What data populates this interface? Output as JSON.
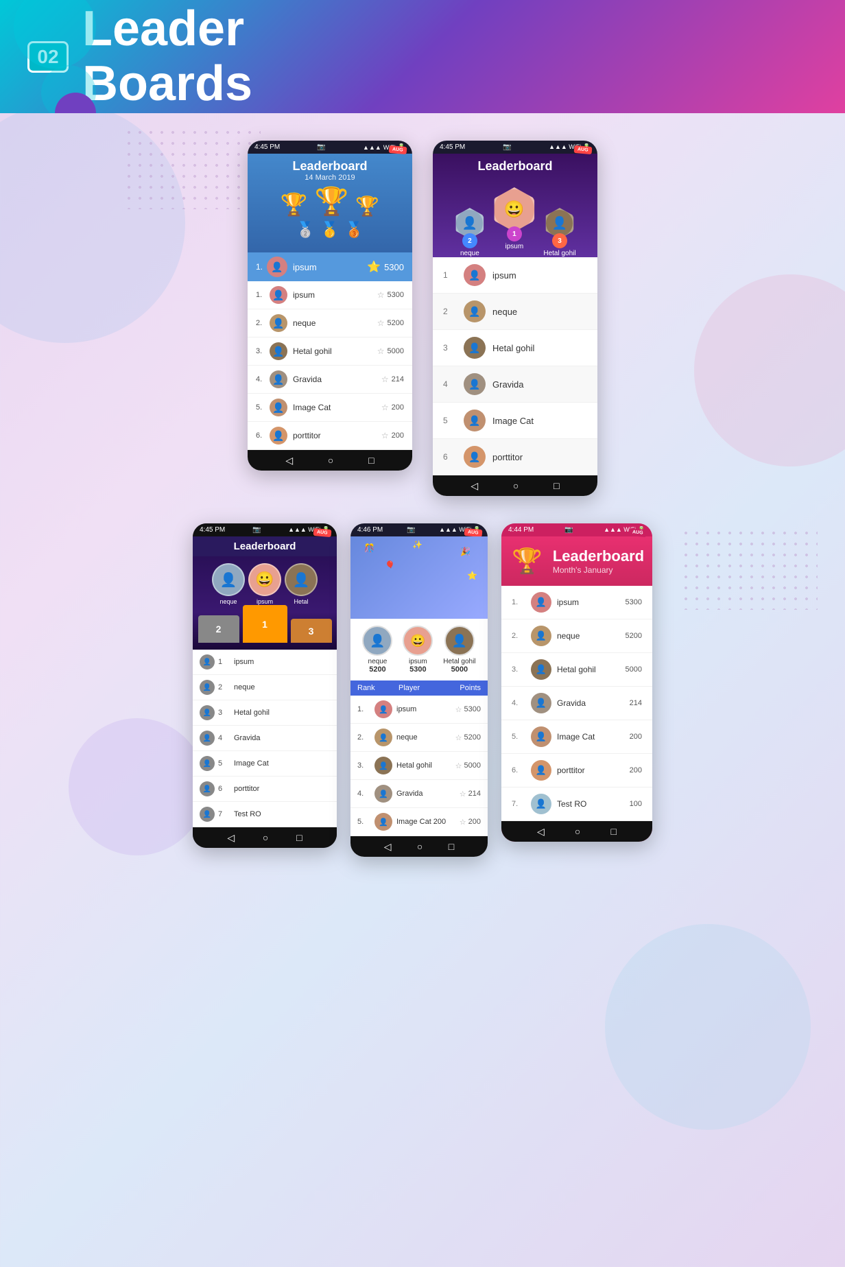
{
  "header": {
    "number": "02",
    "title": "Leader\nBoards"
  },
  "phone1": {
    "status_time": "4:45 PM",
    "title": "Leaderboard",
    "subtitle": "14 March 2019",
    "top_player": {
      "rank": "1.",
      "name": "ipsum",
      "score": "5300"
    },
    "players": [
      {
        "rank": "1.",
        "name": "ipsum",
        "score": "5300"
      },
      {
        "rank": "2.",
        "name": "neque",
        "score": "5200"
      },
      {
        "rank": "3.",
        "name": "Hetal gohil",
        "score": "5000"
      },
      {
        "rank": "4.",
        "name": "Gravida",
        "score": "214"
      },
      {
        "rank": "5.",
        "name": "Image Cat",
        "score": "200"
      },
      {
        "rank": "6.",
        "name": "porttitor",
        "score": "200"
      }
    ]
  },
  "phone2": {
    "status_time": "4:45 PM",
    "title": "Leaderboard",
    "podium": [
      {
        "rank": "2",
        "name": "neque",
        "position": "left"
      },
      {
        "rank": "1",
        "name": "ipsum",
        "position": "center"
      },
      {
        "rank": "3",
        "name": "Hetal gohil",
        "position": "right"
      }
    ],
    "players": [
      {
        "rank": "1",
        "name": "ipsum"
      },
      {
        "rank": "2",
        "name": "neque"
      },
      {
        "rank": "3",
        "name": "Hetal gohil"
      },
      {
        "rank": "4",
        "name": "Gravida"
      },
      {
        "rank": "5",
        "name": "Image Cat"
      },
      {
        "rank": "6",
        "name": "porttitor"
      }
    ]
  },
  "phone3": {
    "status_time": "4:45 PM",
    "title": "Leaderboard",
    "podium": [
      {
        "name": "neque",
        "block": "2"
      },
      {
        "name": "ipsum",
        "block": "1"
      },
      {
        "name": "Hetal",
        "block": "3"
      }
    ],
    "players": [
      {
        "rank": "1",
        "name": "ipsum"
      },
      {
        "rank": "2",
        "name": "neque"
      },
      {
        "rank": "3",
        "name": "Hetal gohil"
      },
      {
        "rank": "4",
        "name": "Gravida"
      },
      {
        "rank": "5",
        "name": "Image Cat"
      },
      {
        "rank": "6",
        "name": "porttitor"
      },
      {
        "rank": "7",
        "name": "Test RO"
      }
    ]
  },
  "phone4": {
    "status_time": "4:46 PM",
    "top_players": [
      {
        "name": "neque",
        "score": "5200"
      },
      {
        "name": "ipsum",
        "score": "5300"
      },
      {
        "name": "Hetal gohil",
        "score": "5000"
      }
    ],
    "table_headers": [
      "Rank",
      "Player",
      "Points"
    ],
    "players": [
      {
        "rank": "1.",
        "name": "ipsum",
        "score": "5300"
      },
      {
        "rank": "2.",
        "name": "neque",
        "score": "5200"
      },
      {
        "rank": "3.",
        "name": "Hetal gohil",
        "score": "5000"
      },
      {
        "rank": "4.",
        "name": "Gravida",
        "score": "214"
      },
      {
        "rank": "5.",
        "name": "Image Cat 200",
        "score": "200"
      }
    ]
  },
  "phone5": {
    "status_time": "4:44 PM",
    "title": "Leaderboard",
    "subtitle": "Month's January",
    "players": [
      {
        "rank": "1.",
        "name": "ipsum",
        "score": "5300"
      },
      {
        "rank": "2.",
        "name": "neque",
        "score": "5200"
      },
      {
        "rank": "3.",
        "name": "Hetal gohil",
        "score": "5000"
      },
      {
        "rank": "4.",
        "name": "Gravida",
        "score": "214"
      },
      {
        "rank": "5.",
        "name": "Image Cat",
        "score": "200"
      },
      {
        "rank": "6.",
        "name": "porttitor",
        "score": "200"
      },
      {
        "rank": "7.",
        "name": "Test RO",
        "score": "100"
      }
    ]
  }
}
